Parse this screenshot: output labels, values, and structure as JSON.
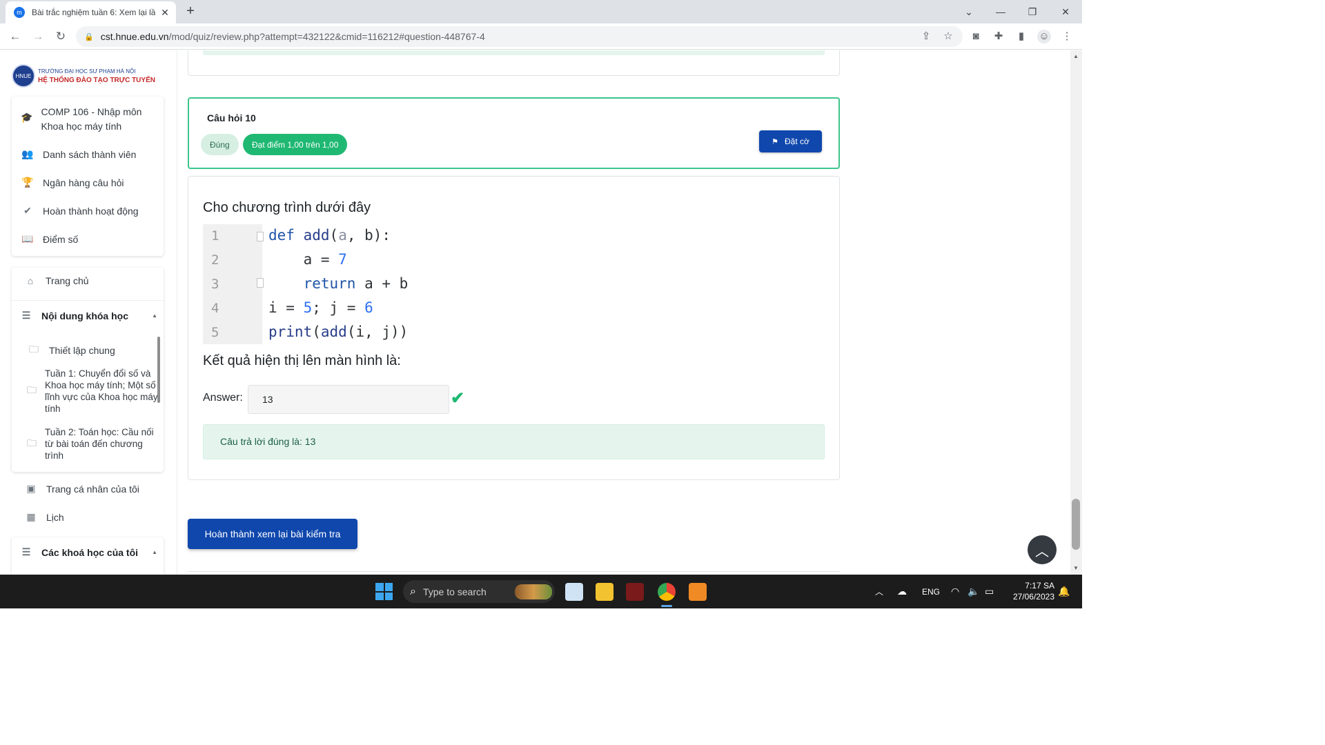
{
  "browser": {
    "tab_title": "Bài trắc nghiệm tuần 6: Xem lại lầ",
    "url_host": "cst.hnue.edu.vn",
    "url_path": "/mod/quiz/review.php?attempt=432122&cmid=116212#question-448767-4"
  },
  "sidebar": {
    "logo_line1": "TRƯỜNG ĐẠI HỌC SƯ PHẠM HÀ NỘI",
    "logo_line2": "HỆ THỐNG ĐÀO TẠO TRỰC TUYẾN",
    "course_items": [
      {
        "label": "COMP 106 - Nhập môn Khoa học máy tính",
        "icon": "graduation-cap-icon"
      },
      {
        "label": "Danh sách thành viên",
        "icon": "users-icon"
      },
      {
        "label": "Ngân hàng câu hỏi",
        "icon": "trophy-icon"
      },
      {
        "label": "Hoàn thành hoạt động",
        "icon": "check-icon"
      },
      {
        "label": "Điểm số",
        "icon": "book-icon"
      }
    ],
    "home": "Trang chủ",
    "course_content_heading": "Nội dung khóa học",
    "sections": [
      "Thiết lập chung",
      "Tuần 1: Chuyển đổi số và Khoa học máy tính; Một số lĩnh vực của Khoa học máy tính",
      "Tuần 2: Toán học: Cầu nối từ bài toán đến chương trình"
    ],
    "profile": "Trang cá nhân của tôi",
    "calendar": "Lịch",
    "my_courses_heading": "Các khoá học của tôi"
  },
  "question": {
    "number": "Câu hỏi 10",
    "state": "Đúng",
    "grade": "Đạt điểm 1,00 trên 1,00",
    "flag_label": "Đặt cờ",
    "text": "Cho chương trình dưới đây",
    "code_lines": [
      "1",
      "2",
      "3",
      "4",
      "5"
    ],
    "prompt": "Kết quả hiện thị lên màn hình là:",
    "answer_label": "Answer:",
    "answer_value": "13",
    "feedback": "Câu trả lời đúng là: 13"
  },
  "finish_button": "Hoàn thành xem lại bài kiểm tra",
  "taskbar": {
    "search_placeholder": "Type to search",
    "language": "ENG",
    "time": "7:17 SA",
    "date": "27/06/2023"
  },
  "colors": {
    "primary": "#0f47ad",
    "success": "#1fb872",
    "success_border": "#3cc58b"
  }
}
